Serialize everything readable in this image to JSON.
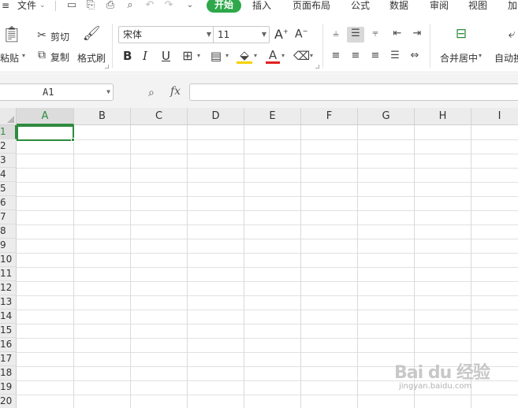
{
  "menubar": {
    "file_label": "文件",
    "tabs": [
      {
        "label": "开始",
        "active": true
      },
      {
        "label": "插入"
      },
      {
        "label": "页面布局"
      },
      {
        "label": "公式"
      },
      {
        "label": "数据"
      },
      {
        "label": "审阅"
      },
      {
        "label": "视图"
      },
      {
        "label": "加"
      }
    ]
  },
  "ribbon": {
    "paste_label": "粘贴",
    "cut_label": "剪切",
    "copy_label": "复制",
    "format_painter_label": "格式刷",
    "font_name": "宋体",
    "font_size": "11",
    "bold": "B",
    "italic": "I",
    "underline": "U",
    "font_color_letter": "A",
    "increase_font": "A",
    "decrease_font": "A",
    "merge_center_label": "合并居中",
    "wrap_label": "自动换",
    "accent_color": "#2ea84a"
  },
  "formula_bar": {
    "name_box": "A1",
    "fx_label": "fx",
    "formula_value": ""
  },
  "grid": {
    "columns": [
      "A",
      "B",
      "C",
      "D",
      "E",
      "F",
      "G",
      "H",
      "I"
    ],
    "rows": [
      "1",
      "2",
      "3",
      "4",
      "5",
      "6",
      "7",
      "8",
      "9",
      "10",
      "11",
      "12",
      "13",
      "14",
      "15",
      "16",
      "17",
      "18",
      "19",
      "20"
    ],
    "selected_cell": "A1",
    "selection_color": "#2e8b3e"
  },
  "watermark": {
    "logo_text": "Bai du 经验",
    "url_text": "jingyan.baidu.com"
  }
}
